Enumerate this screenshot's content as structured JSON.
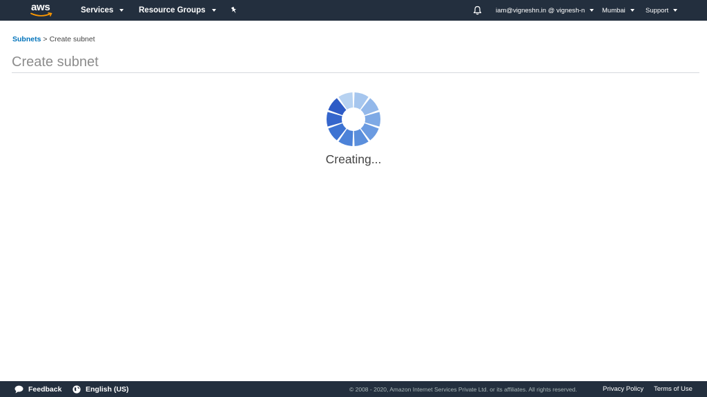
{
  "topnav": {
    "logo_text": "aws",
    "services_label": "Services",
    "resource_groups_label": "Resource Groups",
    "account_label": "iam@vigneshn.in @ vignesh-n",
    "region_label": "Mumbai",
    "support_label": "Support",
    "icons": [
      "pin-icon",
      "bell-icon",
      "chevron-down-icon"
    ]
  },
  "breadcrumb": {
    "parent": "Subnets",
    "separator": ">",
    "current": "Create subnet"
  },
  "page": {
    "title": "Create subnet",
    "status": "Creating..."
  },
  "footer": {
    "feedback_label": "Feedback",
    "language_label": "English (US)",
    "copyright": "© 2008 - 2020, Amazon Internet Services Private Ltd. or its affiliates. All rights reserved.",
    "privacy_label": "Privacy Policy",
    "terms_label": "Terms of Use"
  },
  "colors": {
    "nav_bg": "#232f3e",
    "link": "#0073bb",
    "logo_smile": "#ff9900",
    "spinner_dark": "#2e5bc6",
    "spinner_light": "#b3d0ef"
  }
}
